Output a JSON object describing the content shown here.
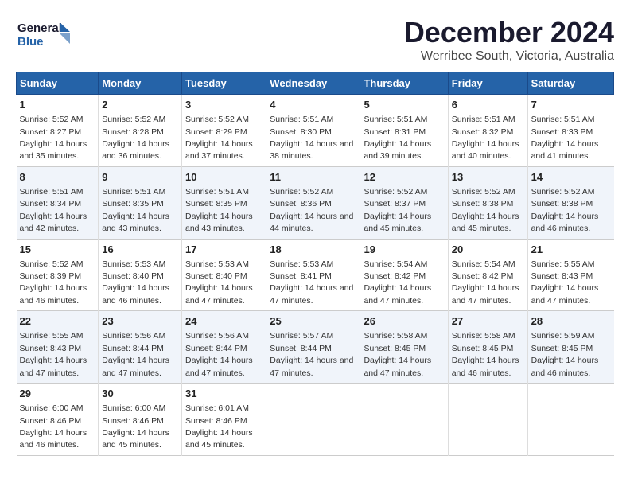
{
  "logo": {
    "line1": "General",
    "line2": "Blue"
  },
  "title": "December 2024",
  "subtitle": "Werribee South, Victoria, Australia",
  "days_of_week": [
    "Sunday",
    "Monday",
    "Tuesday",
    "Wednesday",
    "Thursday",
    "Friday",
    "Saturday"
  ],
  "weeks": [
    [
      {
        "day": "1",
        "sunrise": "5:52 AM",
        "sunset": "8:27 PM",
        "daylight": "14 hours and 35 minutes."
      },
      {
        "day": "2",
        "sunrise": "5:52 AM",
        "sunset": "8:28 PM",
        "daylight": "14 hours and 36 minutes."
      },
      {
        "day": "3",
        "sunrise": "5:52 AM",
        "sunset": "8:29 PM",
        "daylight": "14 hours and 37 minutes."
      },
      {
        "day": "4",
        "sunrise": "5:51 AM",
        "sunset": "8:30 PM",
        "daylight": "14 hours and 38 minutes."
      },
      {
        "day": "5",
        "sunrise": "5:51 AM",
        "sunset": "8:31 PM",
        "daylight": "14 hours and 39 minutes."
      },
      {
        "day": "6",
        "sunrise": "5:51 AM",
        "sunset": "8:32 PM",
        "daylight": "14 hours and 40 minutes."
      },
      {
        "day": "7",
        "sunrise": "5:51 AM",
        "sunset": "8:33 PM",
        "daylight": "14 hours and 41 minutes."
      }
    ],
    [
      {
        "day": "8",
        "sunrise": "5:51 AM",
        "sunset": "8:34 PM",
        "daylight": "14 hours and 42 minutes."
      },
      {
        "day": "9",
        "sunrise": "5:51 AM",
        "sunset": "8:35 PM",
        "daylight": "14 hours and 43 minutes."
      },
      {
        "day": "10",
        "sunrise": "5:51 AM",
        "sunset": "8:35 PM",
        "daylight": "14 hours and 43 minutes."
      },
      {
        "day": "11",
        "sunrise": "5:52 AM",
        "sunset": "8:36 PM",
        "daylight": "14 hours and 44 minutes."
      },
      {
        "day": "12",
        "sunrise": "5:52 AM",
        "sunset": "8:37 PM",
        "daylight": "14 hours and 45 minutes."
      },
      {
        "day": "13",
        "sunrise": "5:52 AM",
        "sunset": "8:38 PM",
        "daylight": "14 hours and 45 minutes."
      },
      {
        "day": "14",
        "sunrise": "5:52 AM",
        "sunset": "8:38 PM",
        "daylight": "14 hours and 46 minutes."
      }
    ],
    [
      {
        "day": "15",
        "sunrise": "5:52 AM",
        "sunset": "8:39 PM",
        "daylight": "14 hours and 46 minutes."
      },
      {
        "day": "16",
        "sunrise": "5:53 AM",
        "sunset": "8:40 PM",
        "daylight": "14 hours and 46 minutes."
      },
      {
        "day": "17",
        "sunrise": "5:53 AM",
        "sunset": "8:40 PM",
        "daylight": "14 hours and 47 minutes."
      },
      {
        "day": "18",
        "sunrise": "5:53 AM",
        "sunset": "8:41 PM",
        "daylight": "14 hours and 47 minutes."
      },
      {
        "day": "19",
        "sunrise": "5:54 AM",
        "sunset": "8:42 PM",
        "daylight": "14 hours and 47 minutes."
      },
      {
        "day": "20",
        "sunrise": "5:54 AM",
        "sunset": "8:42 PM",
        "daylight": "14 hours and 47 minutes."
      },
      {
        "day": "21",
        "sunrise": "5:55 AM",
        "sunset": "8:43 PM",
        "daylight": "14 hours and 47 minutes."
      }
    ],
    [
      {
        "day": "22",
        "sunrise": "5:55 AM",
        "sunset": "8:43 PM",
        "daylight": "14 hours and 47 minutes."
      },
      {
        "day": "23",
        "sunrise": "5:56 AM",
        "sunset": "8:44 PM",
        "daylight": "14 hours and 47 minutes."
      },
      {
        "day": "24",
        "sunrise": "5:56 AM",
        "sunset": "8:44 PM",
        "daylight": "14 hours and 47 minutes."
      },
      {
        "day": "25",
        "sunrise": "5:57 AM",
        "sunset": "8:44 PM",
        "daylight": "14 hours and 47 minutes."
      },
      {
        "day": "26",
        "sunrise": "5:58 AM",
        "sunset": "8:45 PM",
        "daylight": "14 hours and 47 minutes."
      },
      {
        "day": "27",
        "sunrise": "5:58 AM",
        "sunset": "8:45 PM",
        "daylight": "14 hours and 46 minutes."
      },
      {
        "day": "28",
        "sunrise": "5:59 AM",
        "sunset": "8:45 PM",
        "daylight": "14 hours and 46 minutes."
      }
    ],
    [
      {
        "day": "29",
        "sunrise": "6:00 AM",
        "sunset": "8:46 PM",
        "daylight": "14 hours and 46 minutes."
      },
      {
        "day": "30",
        "sunrise": "6:00 AM",
        "sunset": "8:46 PM",
        "daylight": "14 hours and 45 minutes."
      },
      {
        "day": "31",
        "sunrise": "6:01 AM",
        "sunset": "8:46 PM",
        "daylight": "14 hours and 45 minutes."
      },
      null,
      null,
      null,
      null
    ]
  ]
}
